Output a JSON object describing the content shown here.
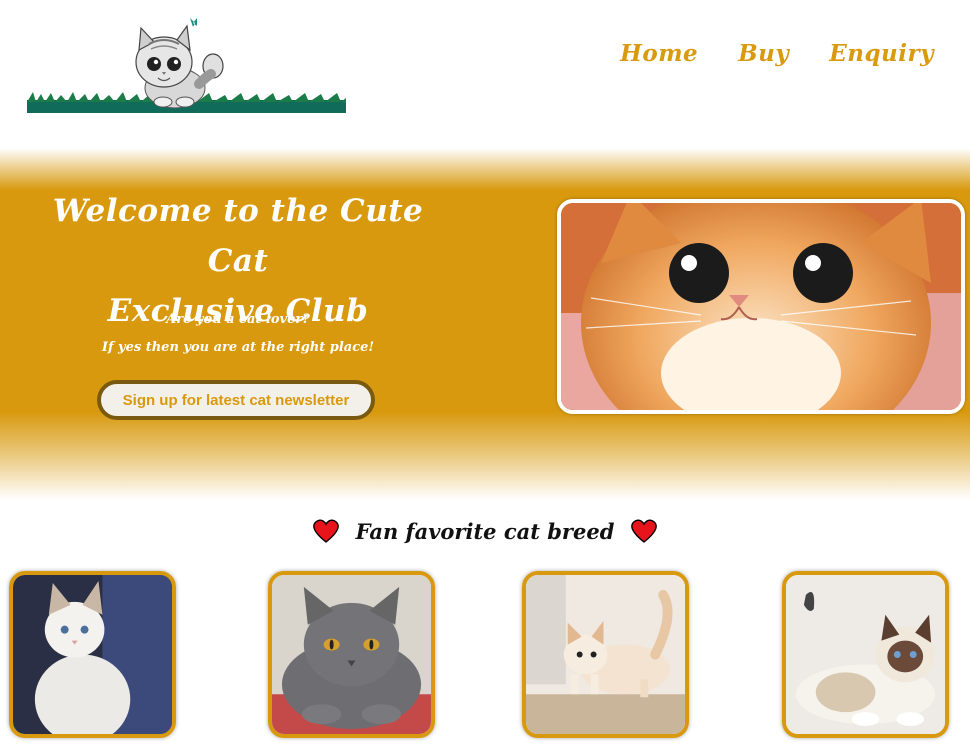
{
  "nav": {
    "items": [
      {
        "label": "Home"
      },
      {
        "label": "Buy"
      },
      {
        "label": "Enquiry"
      }
    ]
  },
  "hero": {
    "title_line1": "Welcome to the Cute Cat",
    "title_line2": "Exclusive Club",
    "subtitle_line1": "Are you a cat lover?",
    "subtitle_line2": "If yes then you are at the right place!",
    "newsletter_button": "Sign up for latest cat newsletter"
  },
  "breeds": {
    "title": "Fan favorite cat breed"
  },
  "colors": {
    "accent": "#d8990e",
    "button_border": "#7a5a10",
    "heart": "#e8141c"
  }
}
